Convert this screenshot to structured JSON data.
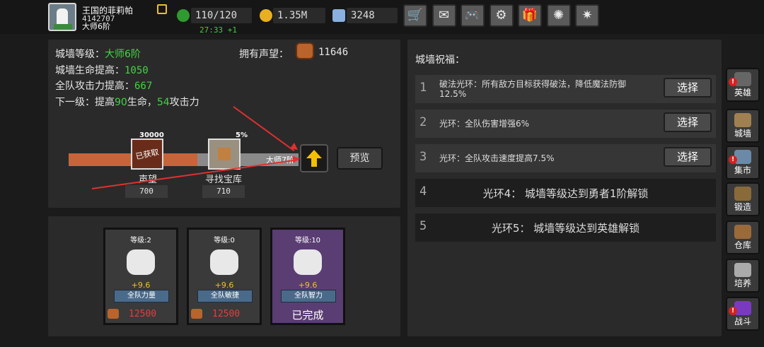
{
  "player": {
    "name": "王国的菲莉帕",
    "id": "4142707",
    "rank": "大师6阶"
  },
  "resources": {
    "stamina": "110/120",
    "timer": "27:33 +1",
    "gold": "1.35M",
    "gems": "3248"
  },
  "toolbar": [
    {
      "name": "cart-icon",
      "glyph": "🛒"
    },
    {
      "name": "mail-icon",
      "glyph": "✉"
    },
    {
      "name": "gamepad-icon",
      "glyph": "🎮"
    },
    {
      "name": "gear-icon",
      "glyph": "⚙"
    },
    {
      "name": "gift-icon",
      "glyph": "🎁"
    },
    {
      "name": "color-wheel-icon",
      "glyph": "✺"
    },
    {
      "name": "firework-icon",
      "glyph": "✷"
    }
  ],
  "wall": {
    "level_label": "城墙等级：",
    "level_value": "大师6阶",
    "hp_label": "城墙生命提高：",
    "hp_value": "1050",
    "atk_label": "全队攻击力提高：",
    "atk_value": "667",
    "next_prefix": "下一级：提高",
    "next_hp": "90",
    "next_mid": "生命，",
    "next_atk": "54",
    "next_suffix": "攻击力",
    "prestige_label": "拥有声望：",
    "prestige_value": "11646",
    "node1_top": "30000",
    "node1_stamp": "已获取",
    "node1_label": "声望",
    "node1_value": "700",
    "node2_top": "5%",
    "node2_label": "寻找宝库",
    "node2_value": "710",
    "next_rank": "大师7阶",
    "preview": "预览",
    "progress": 0.56
  },
  "cards": [
    {
      "level": "等级:2",
      "plus": "+9.6",
      "label": "全队力量",
      "cost": "12500",
      "color": "#3a3a3a",
      "done": ""
    },
    {
      "level": "等级:0",
      "plus": "+9.6",
      "label": "全队敏捷",
      "cost": "12500",
      "color": "#3a3a3a",
      "done": ""
    },
    {
      "level": "等级:10",
      "plus": "+9.6",
      "label": "全队智力",
      "cost": "",
      "color": "#5a3d73",
      "done": "已完成"
    }
  ],
  "blessings": {
    "title": "城墙祝福：",
    "items": [
      {
        "num": "1",
        "text": "破法光环：所有敌方目标获得破法，降低魔法防御",
        "text2": "12.5%",
        "btn": "选择"
      },
      {
        "num": "2",
        "text": "光环：全队伤害增强6%",
        "text2": "",
        "btn": "选择"
      },
      {
        "num": "3",
        "text": "光环：全队攻击速度提高7.5%",
        "text2": "",
        "btn": "选择"
      },
      {
        "num": "4",
        "text": "光环4：  城墙等级达到勇者1阶解锁",
        "text2": "",
        "btn": ""
      },
      {
        "num": "5",
        "text": "光环5：  城墙等级达到英雄解锁",
        "text2": "",
        "btn": ""
      }
    ]
  },
  "sidebar": [
    {
      "label": "英雄",
      "badge": "!",
      "color": "#666"
    },
    {
      "label": "城墙",
      "badge": "",
      "color": "#a08050"
    },
    {
      "label": "集市",
      "badge": "!",
      "color": "#6a8aa8"
    },
    {
      "label": "锻造",
      "badge": "",
      "color": "#8a6a3a"
    },
    {
      "label": "仓库",
      "badge": "",
      "color": "#9a6a3a"
    },
    {
      "label": "培养",
      "badge": "",
      "color": "#aaa"
    },
    {
      "label": "战斗",
      "badge": "!",
      "color": "#7a3ac0"
    }
  ]
}
